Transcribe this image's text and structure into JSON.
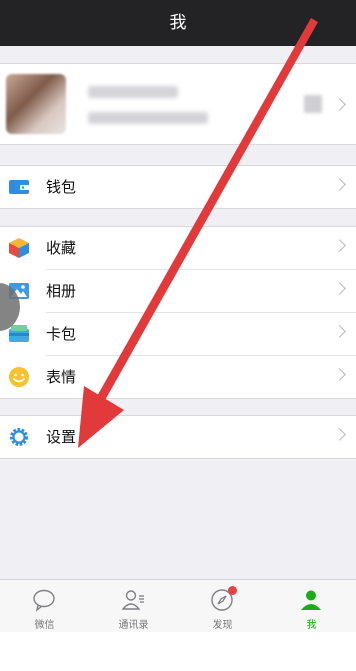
{
  "header": {
    "title": "我"
  },
  "menu": {
    "wallet": "钱包",
    "favorites": "收藏",
    "album": "相册",
    "cards": "卡包",
    "stickers": "表情",
    "settings": "设置"
  },
  "tabbar": {
    "tabs": [
      {
        "label": "微信",
        "icon": "chat-icon"
      },
      {
        "label": "通讯录",
        "icon": "contacts-icon"
      },
      {
        "label": "发现",
        "icon": "compass-icon"
      },
      {
        "label": "我",
        "icon": "me-icon",
        "active": true
      }
    ]
  },
  "colors": {
    "header": "#232325",
    "accent": "#1aad19",
    "arrow": "#e23a3a"
  }
}
